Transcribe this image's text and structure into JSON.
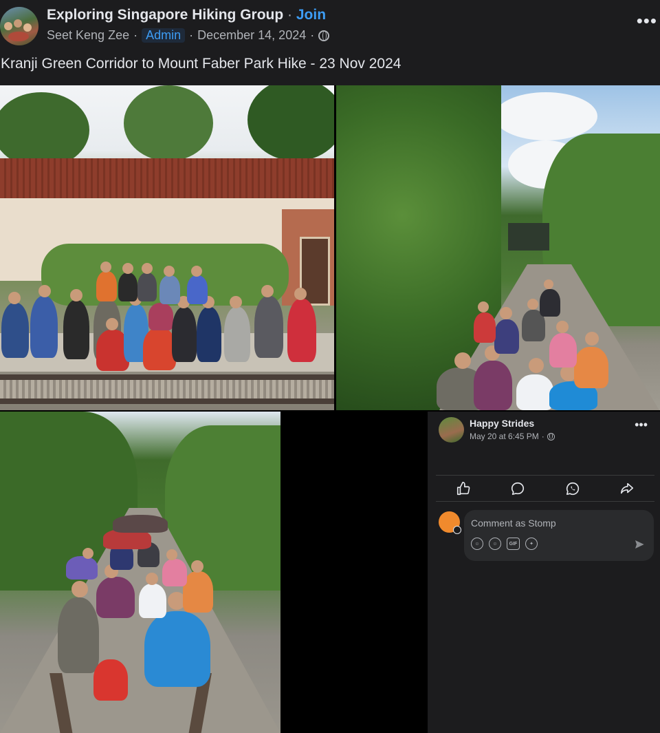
{
  "post": {
    "group_name": "Exploring Singapore Hiking Group",
    "join_label": "Join",
    "author": "Seet Keng Zee",
    "author_badge": "Admin",
    "date": "December 14, 2024",
    "caption": "Kranji Green Corridor to Mount Faber Park Hike - 23 Nov 2024",
    "more_icon": "more-horizontal-icon",
    "privacy_icon": "globe-icon"
  },
  "comment_panel": {
    "poster_name": "Happy Strides",
    "timestamp": "May 20 at 6:45 PM",
    "actions": [
      "like-icon",
      "comment-icon",
      "whatsapp-icon",
      "share-icon"
    ],
    "composer": {
      "placeholder": "Comment as Stomp",
      "tools": [
        "avatar-sticker-icon",
        "emoji-icon",
        "gif-icon",
        "sticker-icon"
      ],
      "send_icon": "send-icon"
    }
  },
  "colors": {
    "background": "#1c1c1e",
    "accent": "#3d9df5",
    "text_primary": "#e4e6eb",
    "text_secondary": "#b0b3b8",
    "commenter_avatar": "#f08a2d"
  }
}
